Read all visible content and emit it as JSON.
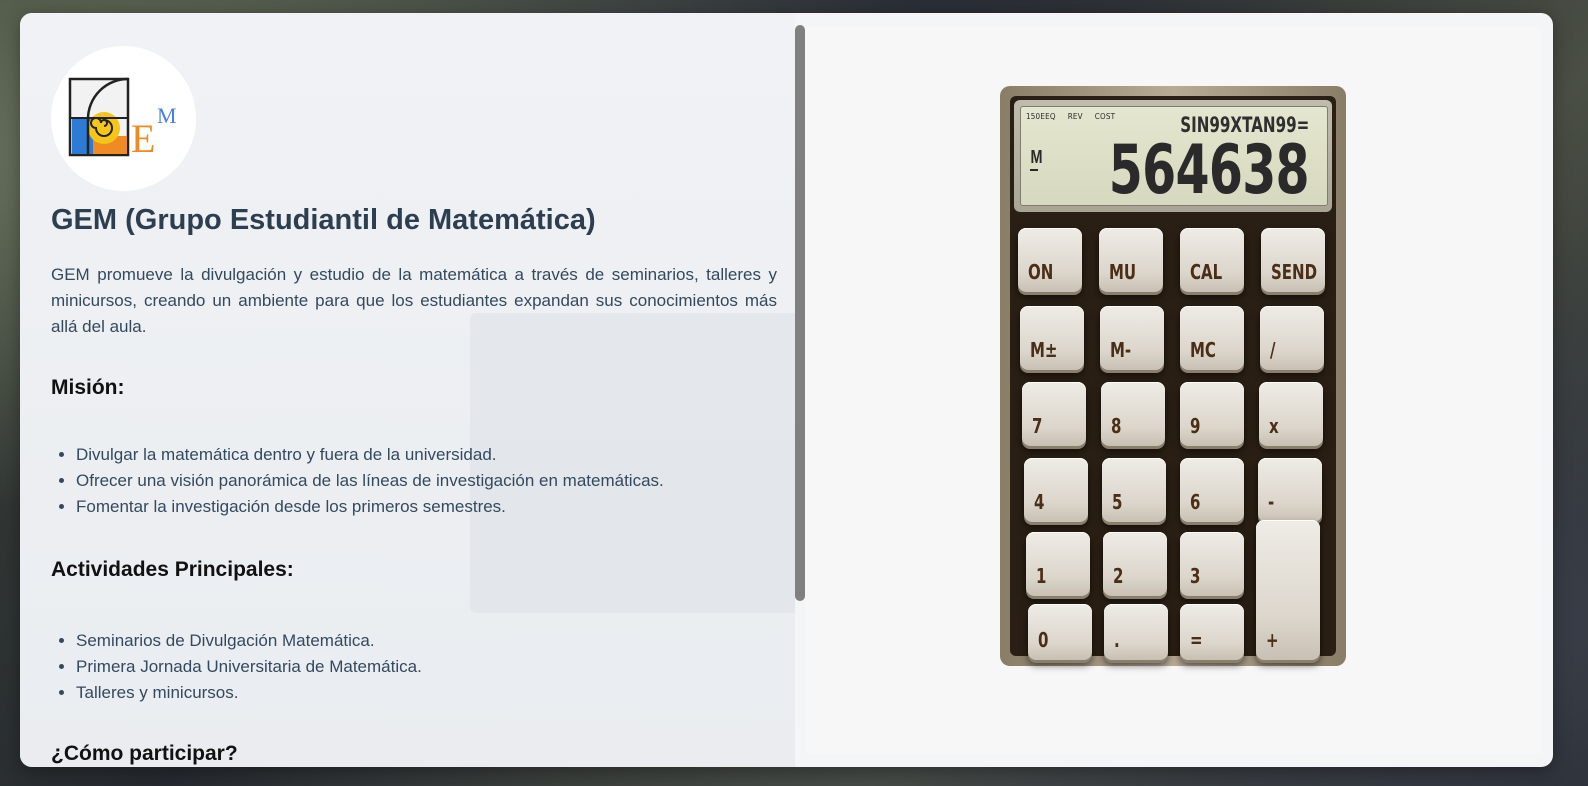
{
  "org": {
    "title": "GEM (Grupo Estudiantil de Matemática)",
    "description": "GEM promueve la divulgación y estudio de la matemática a través de seminarios, talleres y minicursos, creando un ambiente para que los estudiantes expandan sus conocimientos más allá del aula.",
    "logo": {
      "letters": "E",
      "superscript": "M"
    }
  },
  "mission": {
    "heading": "Misión:",
    "items": [
      "Divulgar la matemática dentro y fuera de la universidad.",
      "Ofrecer una visión panorámica de las líneas de investigación en matemáticas.",
      "Fomentar la investigación desde los primeros semestres."
    ]
  },
  "activities": {
    "heading": "Actividades Principales:",
    "items": [
      "Seminarios de Divulgación Matemática.",
      "Primera Jornada Universitaria de Matemática.",
      "Talleres y minicursos."
    ]
  },
  "participate": {
    "heading": "¿Cómo participar?"
  },
  "calculator": {
    "flags": [
      "150EEQ",
      "REV",
      "COST"
    ],
    "expression": "SIN99XTAN99=",
    "memory_indicator": "M",
    "display_value": "564638",
    "keys": [
      [
        "ON",
        "MU",
        "CAL",
        "SEND"
      ],
      [
        "M±",
        "M-",
        "MC",
        "/"
      ],
      [
        "7",
        "8",
        "9",
        "x"
      ],
      [
        "4",
        "5",
        "6",
        "-"
      ],
      [
        "1",
        "2",
        "3"
      ],
      [
        "0",
        ".",
        "=",
        "+"
      ]
    ]
  },
  "colors": {
    "title": "#2c3e50",
    "text": "#34495e",
    "logo_blue": "#2e7bd6",
    "logo_orange": "#f08a24",
    "logo_yellow": "#f5c518"
  }
}
